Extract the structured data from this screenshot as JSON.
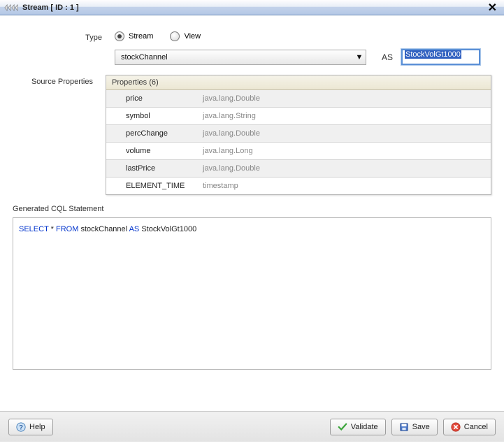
{
  "titlebar": {
    "title": "Stream [ ID : 1 ]"
  },
  "form": {
    "type_label": "Type",
    "type_options": {
      "stream": "Stream",
      "view": "View"
    },
    "type_selected": "stream",
    "source_label": "stockChannel",
    "as_label": "AS",
    "as_value": "StockVolGt1000",
    "src_props_label": "Source Properties",
    "props_header": "Properties (6)"
  },
  "properties": [
    {
      "name": "price",
      "type": "java.lang.Double"
    },
    {
      "name": "symbol",
      "type": "java.lang.String"
    },
    {
      "name": "percChange",
      "type": "java.lang.Double"
    },
    {
      "name": "volume",
      "type": "java.lang.Long"
    },
    {
      "name": "lastPrice",
      "type": "java.lang.Double"
    },
    {
      "name": "ELEMENT_TIME",
      "type": "timestamp"
    }
  ],
  "cql": {
    "section_title": "Generated CQL Statement",
    "select": "SELECT",
    "star": "*",
    "from": "FROM",
    "source": "stockChannel",
    "as": "AS",
    "alias": "StockVolGt1000"
  },
  "buttons": {
    "help": "Help",
    "validate": "Validate",
    "save": "Save",
    "cancel": "Cancel"
  }
}
